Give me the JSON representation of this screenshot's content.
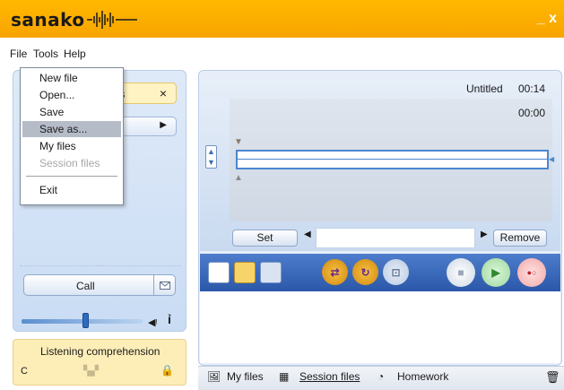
{
  "app": {
    "brand": "sanako",
    "window_close": "_ x"
  },
  "menubar": {
    "file": "File",
    "tools": "Tools",
    "help": "Help"
  },
  "file_menu": {
    "items": [
      {
        "label": "New file",
        "state": "normal"
      },
      {
        "label": "Open...",
        "state": "normal"
      },
      {
        "label": "Save",
        "state": "normal"
      },
      {
        "label": "Save as...",
        "state": "highlighted"
      },
      {
        "label": "My files",
        "state": "normal"
      },
      {
        "label": "Session files",
        "state": "disabled"
      },
      {
        "label": "Exit",
        "state": "normal"
      }
    ]
  },
  "left_panel": {
    "tab_label_partial": "les",
    "tab_close": "×",
    "call_label": "Call",
    "volume_level": 0.52,
    "exercise_title": "Listening comprehension",
    "exercise_code": "C"
  },
  "recorder": {
    "file_name": "Untitled",
    "duration": "00:14",
    "position": "00:00",
    "set_label": "Set",
    "remove_label": "Remove"
  },
  "bottom_tabs": {
    "my_files": "My files",
    "session_files": "Session files",
    "homework": "Homework"
  },
  "colors": {
    "titlebar": "#f9a400",
    "toolbar": "#2b57a8",
    "panel": "#c9dcf4",
    "exercise": "#fdeeb8",
    "highlight": "#b5bcc8"
  }
}
